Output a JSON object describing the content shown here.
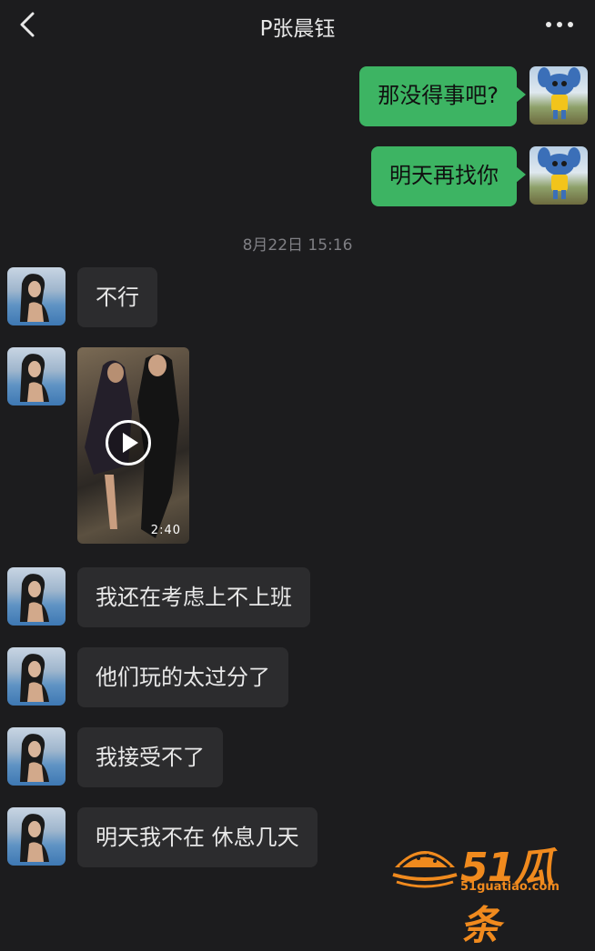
{
  "header": {
    "title": "P张晨钰"
  },
  "messages": {
    "m1": "那没得事吧?",
    "m2": "明天再找你",
    "timestamp": "8月22日 15:16",
    "m3": "不行",
    "video_duration": "2:40",
    "m4": "我还在考虑上不上班",
    "m5": "他们玩的太过分了",
    "m6": "我接受不了",
    "m7": "明天我不在 休息几天"
  },
  "watermark": {
    "brand": "51瓜条",
    "domain": "51guatiao.com"
  },
  "colors": {
    "background": "#1c1c1e",
    "bubble_sent": "#3db463",
    "bubble_received": "#2c2c2e",
    "watermark": "#f08a1e"
  }
}
